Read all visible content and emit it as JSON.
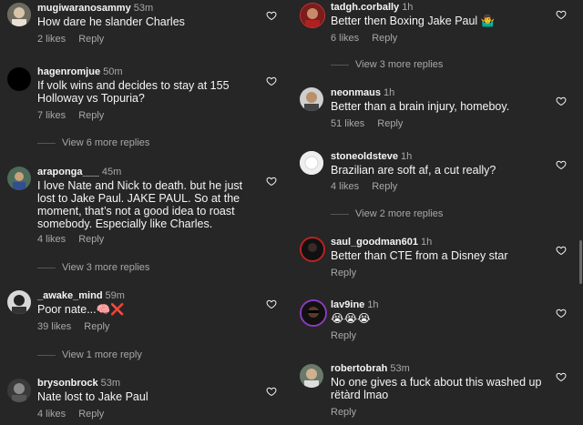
{
  "left_comments": [
    {
      "username": "mugiwaranosammy",
      "time": "53m",
      "text": "How dare he slander Charles",
      "likes": "2 likes",
      "reply": "Reply",
      "avatar": "sammy-avatar"
    },
    {
      "username": "hagenromjue",
      "time": "50m",
      "text": "If volk wins and decides to stay at 155 Holloway vs Topuria?",
      "likes": "7 likes",
      "reply": "Reply",
      "view_more": "View 6 more replies",
      "avatar": "black-avatar"
    },
    {
      "username": "araponga___",
      "time": "45m",
      "text": "I love Nate and Nick to death. but he just lost to Jake Paul. JAKE PAUL. So at the moment, that’s not a good idea to roast somebody. Especially like Charles.",
      "likes": "4 likes",
      "reply": "Reply",
      "view_more": "View 3 more replies",
      "avatar": "araponga-avatar"
    },
    {
      "username": "_awake_mind",
      "time": "59m",
      "text": "Poor nate...",
      "likes": "39 likes",
      "reply": "Reply",
      "view_more": "View 1 more reply",
      "avatar": "awake-avatar"
    },
    {
      "username": "brysonbrock",
      "time": "53m",
      "text": "Nate lost to Jake Paul",
      "likes": "4 likes",
      "reply": "Reply",
      "avatar": "bryson-avatar"
    }
  ],
  "right_comments": [
    {
      "username": "tadgh.corbally",
      "time": "1h",
      "text": "Better then Boxing Jake Paul",
      "likes": "6 likes",
      "reply": "Reply",
      "view_more": "View 3 more replies",
      "avatar": "tadgh-avatar"
    },
    {
      "username": "neonmaus",
      "time": "1h",
      "text": "Better than a brain injury, homeboy.",
      "likes": "51 likes",
      "reply": "Reply",
      "avatar": "neon-avatar"
    },
    {
      "username": "stoneoldsteve",
      "time": "1h",
      "text": "Brazilian are soft af, a cut really?",
      "likes": "4 likes",
      "reply": "Reply",
      "view_more": "View 2 more replies",
      "avatar": "default-avatar"
    },
    {
      "username": "saul_goodman601",
      "time": "1h",
      "text": "Better than CTE from a Disney star",
      "likes": "",
      "reply": "Reply",
      "avatar": "saul-avatar"
    },
    {
      "username": "lav9ine",
      "time": "1h",
      "text": "😭😭😭",
      "likes": "",
      "reply": "Reply",
      "avatar": "lav-avatar"
    },
    {
      "username": "robertobrah",
      "time": "53m",
      "text": "No one gives a fuck about this washed up rëtàrd lmao",
      "likes": "",
      "reply": "Reply",
      "avatar": "roberto-avatar"
    }
  ],
  "emojis": {
    "shrug": "🤷‍♂️",
    "brain": "🧠",
    "cross": "❌"
  },
  "colors": {
    "background": "#262626",
    "muted": "#a8a8a8",
    "text": "#f5f5f5"
  }
}
